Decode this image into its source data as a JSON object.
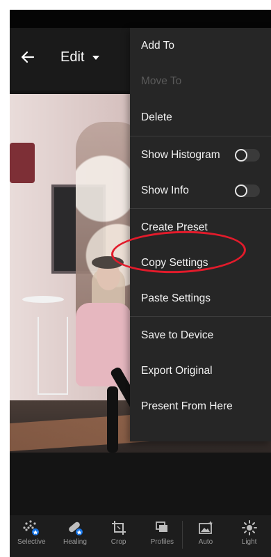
{
  "header": {
    "title": "Edit"
  },
  "menu": {
    "items": [
      {
        "label": "Add To"
      },
      {
        "label": "Move To"
      },
      {
        "label": "Delete"
      },
      {
        "label": "Show Histogram"
      },
      {
        "label": "Show Info"
      },
      {
        "label": "Create Preset"
      },
      {
        "label": "Copy Settings"
      },
      {
        "label": "Paste Settings"
      },
      {
        "label": "Save to Device"
      },
      {
        "label": "Export Original"
      },
      {
        "label": "Present From Here"
      }
    ]
  },
  "toolbar": {
    "items": [
      {
        "label": "Selective",
        "icon": "selective-icon"
      },
      {
        "label": "Healing",
        "icon": "healing-icon"
      },
      {
        "label": "Crop",
        "icon": "crop-icon"
      },
      {
        "label": "Profiles",
        "icon": "profiles-icon"
      },
      {
        "label": "Auto",
        "icon": "auto-icon"
      },
      {
        "label": "Light",
        "icon": "light-icon"
      }
    ]
  },
  "colors": {
    "menu_bg": "#262626",
    "annotation_red": "#e21b2b",
    "badge_blue": "#1473e6"
  }
}
